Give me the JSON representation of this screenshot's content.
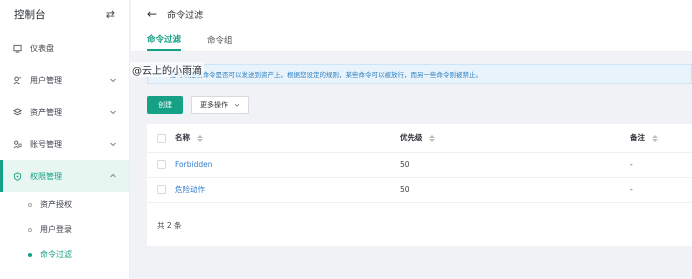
{
  "sidebar": {
    "title": "控制台",
    "items": [
      {
        "label": "仪表盘",
        "icon": "dashboard-icon"
      },
      {
        "label": "用户管理",
        "icon": "user-icon"
      },
      {
        "label": "资产管理",
        "icon": "asset-icon"
      },
      {
        "label": "账号管理",
        "icon": "account-icon"
      },
      {
        "label": "权限管理",
        "icon": "shield-icon"
      }
    ],
    "subitems": [
      {
        "label": "资产授权"
      },
      {
        "label": "用户登录"
      },
      {
        "label": "命令过滤"
      }
    ]
  },
  "header": {
    "title": "命令过滤"
  },
  "tabs": [
    {
      "label": "命令过滤"
    },
    {
      "label": "命令组"
    }
  ],
  "watermark": "@云上的小雨滴",
  "notice": "您可以控制命令是否可以发送到资产上。根据您设定的规则，某些命令可以被放行，而另一些命令则被禁止。",
  "toolbar": {
    "create_label": "创建",
    "more_label": "更多操作"
  },
  "table": {
    "headers": {
      "name": "名称",
      "priority": "优先级",
      "note": "备注"
    },
    "rows": [
      {
        "name": "Forbidden",
        "priority": "50",
        "note": "-"
      },
      {
        "name": "危险动作",
        "priority": "50",
        "note": "-"
      }
    ],
    "total": "共 2 条"
  },
  "colors": {
    "accent": "#16a085",
    "link": "#2e7ccd",
    "notice_bg": "#e8f3fb"
  }
}
